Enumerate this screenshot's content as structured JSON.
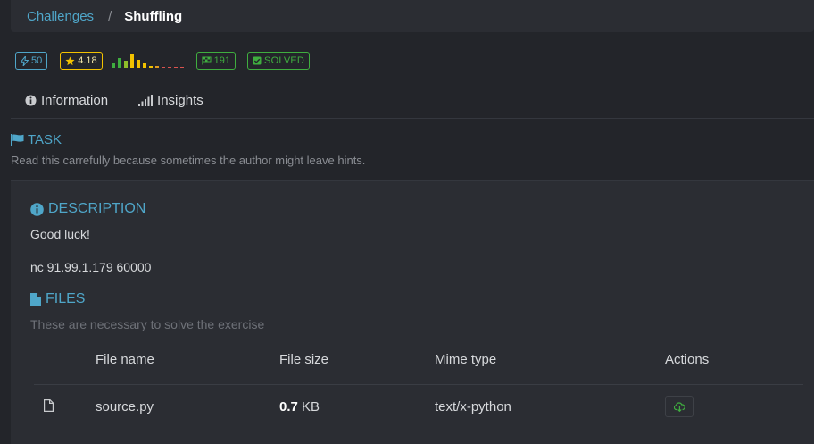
{
  "breadcrumb": {
    "parent": "Challenges",
    "separator": "/",
    "current": "Shuffling"
  },
  "badges": {
    "points": "50",
    "rating": "4.18",
    "solves": "191",
    "status": "SOLVED"
  },
  "rating_distribution": [
    {
      "level": 0.35,
      "color": "#3fae3f"
    },
    {
      "level": 0.75,
      "color": "#3fae3f"
    },
    {
      "level": 0.55,
      "color": "#8fbf2a"
    },
    {
      "level": 1.0,
      "color": "#f2c200"
    },
    {
      "level": 0.6,
      "color": "#f2c200"
    },
    {
      "level": 0.3,
      "color": "#f2c200"
    },
    {
      "level": 0.15,
      "color": "#f2c200"
    },
    {
      "level": 0.1,
      "color": "#e09a20"
    },
    {
      "level": 0.08,
      "color": "#d9534f"
    },
    {
      "level": 0.08,
      "color": "#d9534f"
    },
    {
      "level": 0.08,
      "color": "#d9534f"
    },
    {
      "level": 0.08,
      "color": "#d9534f"
    }
  ],
  "tabs": [
    {
      "label": "Information",
      "icon": "info-circle-icon"
    },
    {
      "label": "Insights",
      "icon": "signal-bars-icon"
    }
  ],
  "task": {
    "title": "TASK",
    "subtitle": "Read this carrefully because sometimes the author might leave hints."
  },
  "description": {
    "title": "DESCRIPTION",
    "lines": [
      "Good luck!",
      "nc 91.99.1.179 60000"
    ]
  },
  "files": {
    "title": "FILES",
    "subtitle": "These are necessary to solve the exercise",
    "columns": [
      "File name",
      "File size",
      "Mime type",
      "Actions"
    ],
    "rows": [
      {
        "name": "source.py",
        "size_value": "0.7",
        "size_unit": "KB",
        "mime": "text/x-python"
      }
    ]
  },
  "colors": {
    "accent": "#4fa6c9",
    "success": "#3fae3f",
    "star": "#f2c200",
    "background": "#23252a",
    "panel": "#2b2d33"
  }
}
